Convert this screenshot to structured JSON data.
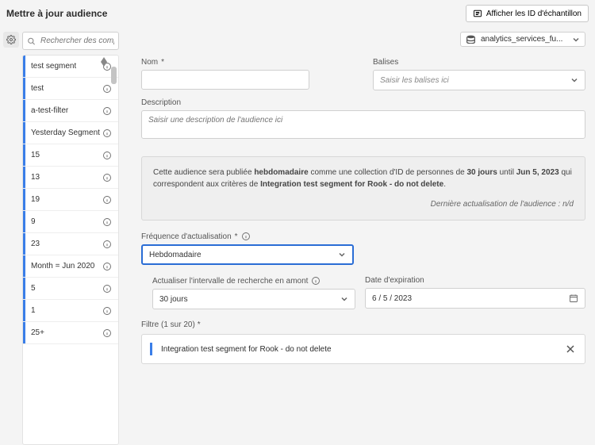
{
  "header": {
    "title": "Mettre à jour audience",
    "sample_button": "Afficher les ID d'échantillon"
  },
  "dataview": {
    "selected": "analytics_services_fu..."
  },
  "sidebar": {
    "search_placeholder": "Rechercher des composants",
    "items": [
      {
        "label": "test segment"
      },
      {
        "label": "test"
      },
      {
        "label": "a-test-filter"
      },
      {
        "label": "Yesterday Segment"
      },
      {
        "label": "15"
      },
      {
        "label": "13"
      },
      {
        "label": "19"
      },
      {
        "label": "9"
      },
      {
        "label": "23"
      },
      {
        "label": "Month = Jun 2020"
      },
      {
        "label": "5"
      },
      {
        "label": "1"
      },
      {
        "label": "25+"
      }
    ]
  },
  "form": {
    "name_label": "Nom",
    "tags_label": "Balises",
    "tags_placeholder": "Saisir les balises ici",
    "description_label": "Description",
    "description_placeholder": "Saisir une description de l'audience ici",
    "notice_pre": "Cette audience sera publiée ",
    "notice_freq": "hebdomadaire",
    "notice_mid1": " comme une collection d'ID de personnes de ",
    "notice_days": "30 jours",
    "notice_mid2": " until ",
    "notice_date": "Jun 5, 2023",
    "notice_mid3": " qui correspondent aux critères de ",
    "notice_seg": "Integration test segment for Rook - do not delete",
    "notice_end": ".",
    "last_updated": "Dernière actualisation de l'audience : n/d",
    "freq_label": "Fréquence d'actualisation",
    "freq_value": "Hebdomadaire",
    "lookback_label": "Actualiser l'intervalle de recherche en amont",
    "lookback_value": "30 jours",
    "expiry_label": "Date d'expiration",
    "expiry_value": "6 / 5 / 2023",
    "filter_header": "Filtre (1 sur 20)",
    "filter_name": "Integration test segment for Rook - do not delete"
  }
}
